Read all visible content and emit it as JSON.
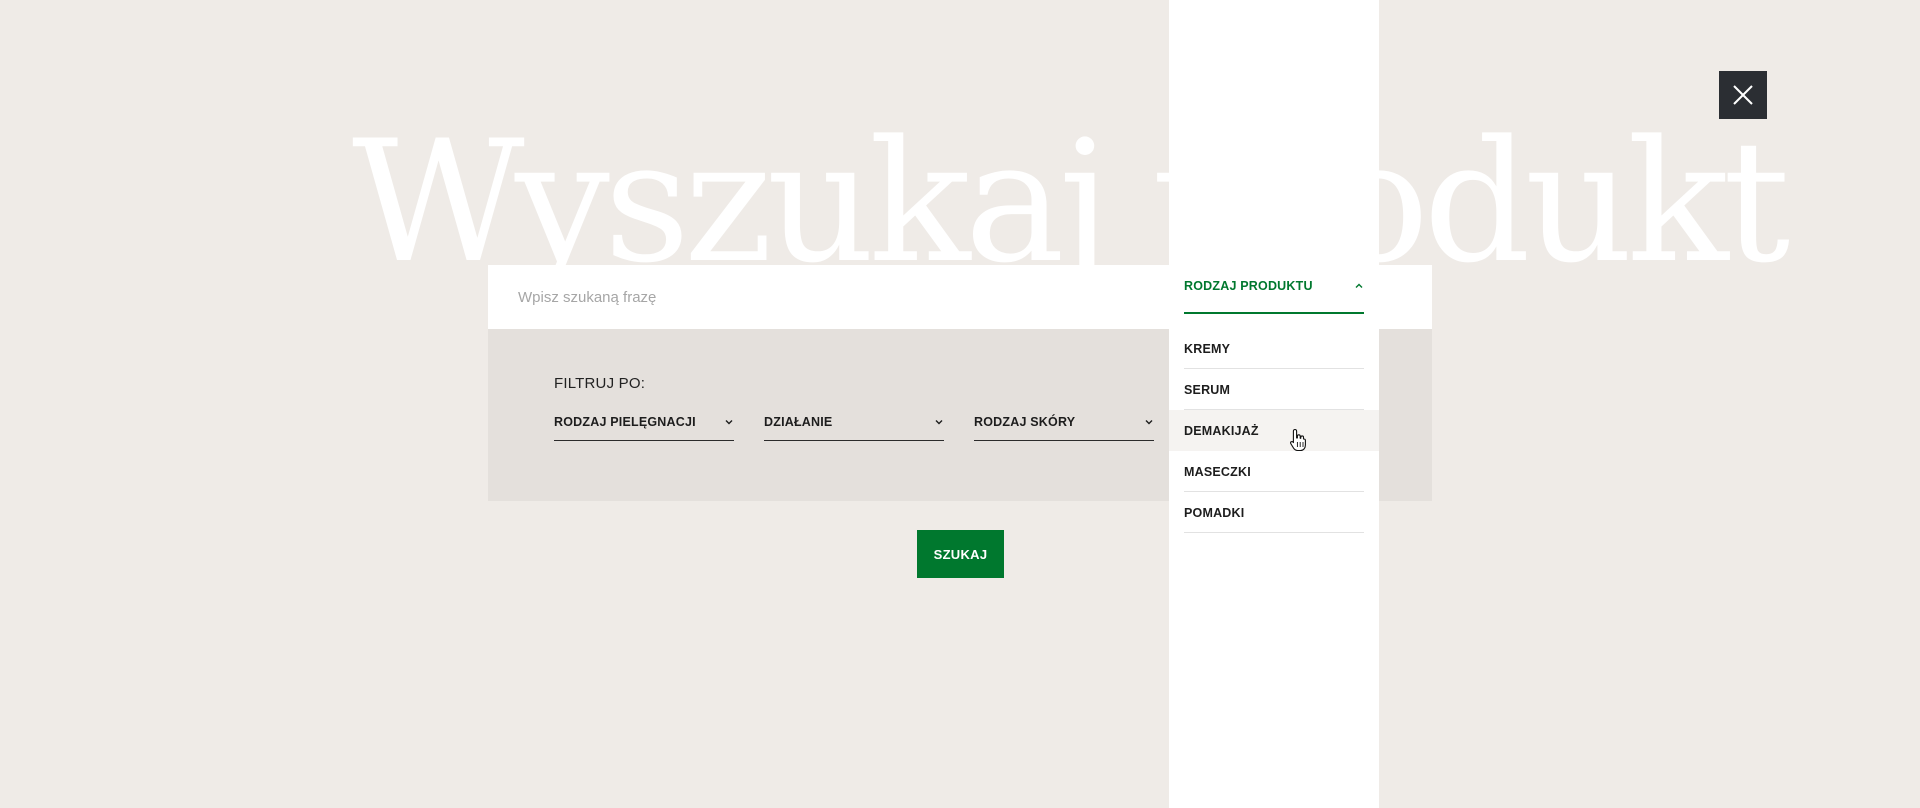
{
  "hero": {
    "title": "Wyszukaj produkt"
  },
  "search": {
    "placeholder": "Wpisz szukaną frazę",
    "value": ""
  },
  "filters": {
    "label": "FILTRUJ PO:",
    "selects": [
      {
        "label": "RODZAJ PIELĘGNACJI",
        "icon": "chevron-down-icon"
      },
      {
        "label": "DZIAŁANIE",
        "icon": "chevron-down-icon"
      },
      {
        "label": "RODZAJ SKÓRY",
        "icon": "chevron-down-icon"
      }
    ]
  },
  "submit": {
    "label": "SZUKAJ"
  },
  "dropdown": {
    "title": "RODZAJ PRODUKTU",
    "icon": "chevron-up-icon",
    "items": [
      {
        "label": "KREMY"
      },
      {
        "label": "SERUM"
      },
      {
        "label": "DEMAKIJAŻ"
      },
      {
        "label": "MASECZKI"
      },
      {
        "label": "POMADKI"
      }
    ],
    "hovered_item": "DEMAKIJAŻ"
  },
  "colors": {
    "accent_green": "#00782e",
    "background": "#efebe7",
    "panel": "#e4e0dc",
    "close_button": "#2b2e33"
  },
  "icons": {
    "close": "close-icon",
    "cursor": "hand-pointer-icon"
  }
}
